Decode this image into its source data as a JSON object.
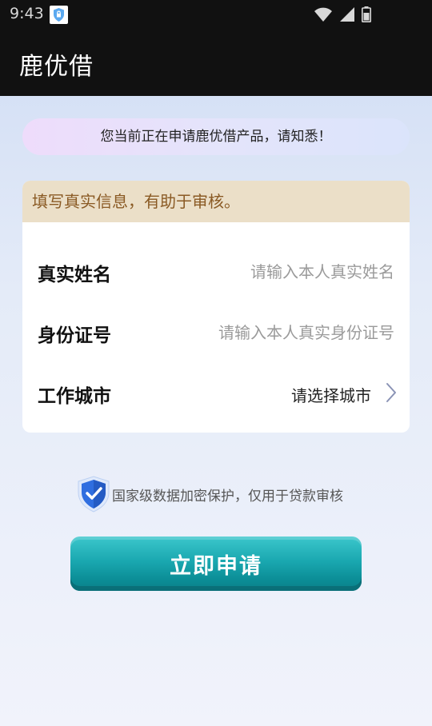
{
  "status_bar": {
    "time": "9:43",
    "icons": [
      "app-lock-icon",
      "wifi-icon",
      "signal-icon",
      "battery-icon"
    ]
  },
  "app_bar": {
    "title": "鹿优借"
  },
  "notice": {
    "text": "您当前正在申请鹿优借产品，请知悉！"
  },
  "form": {
    "header": "填写真实信息，有助于审核。",
    "fields": [
      {
        "label": "真实姓名",
        "value": "",
        "placeholder": "请输入本人真实姓名"
      },
      {
        "label": "身份证号",
        "value": "",
        "placeholder": "请输入本人真实身份证号"
      },
      {
        "label": "工作城市",
        "value": "请选择城市",
        "icon": "chevron-right-icon"
      }
    ]
  },
  "security": {
    "icon": "shield-check-icon",
    "text": "国家级数据加密保护，仅用于贷款审核"
  },
  "apply_button": {
    "label": "立即申请"
  },
  "colors": {
    "app_bar_bg": "#111111",
    "header_bg": "#ebdfc8",
    "header_text": "#8a5a24",
    "button_accent": "#1aa8b0",
    "shield_blue": "#2f6ee0"
  }
}
